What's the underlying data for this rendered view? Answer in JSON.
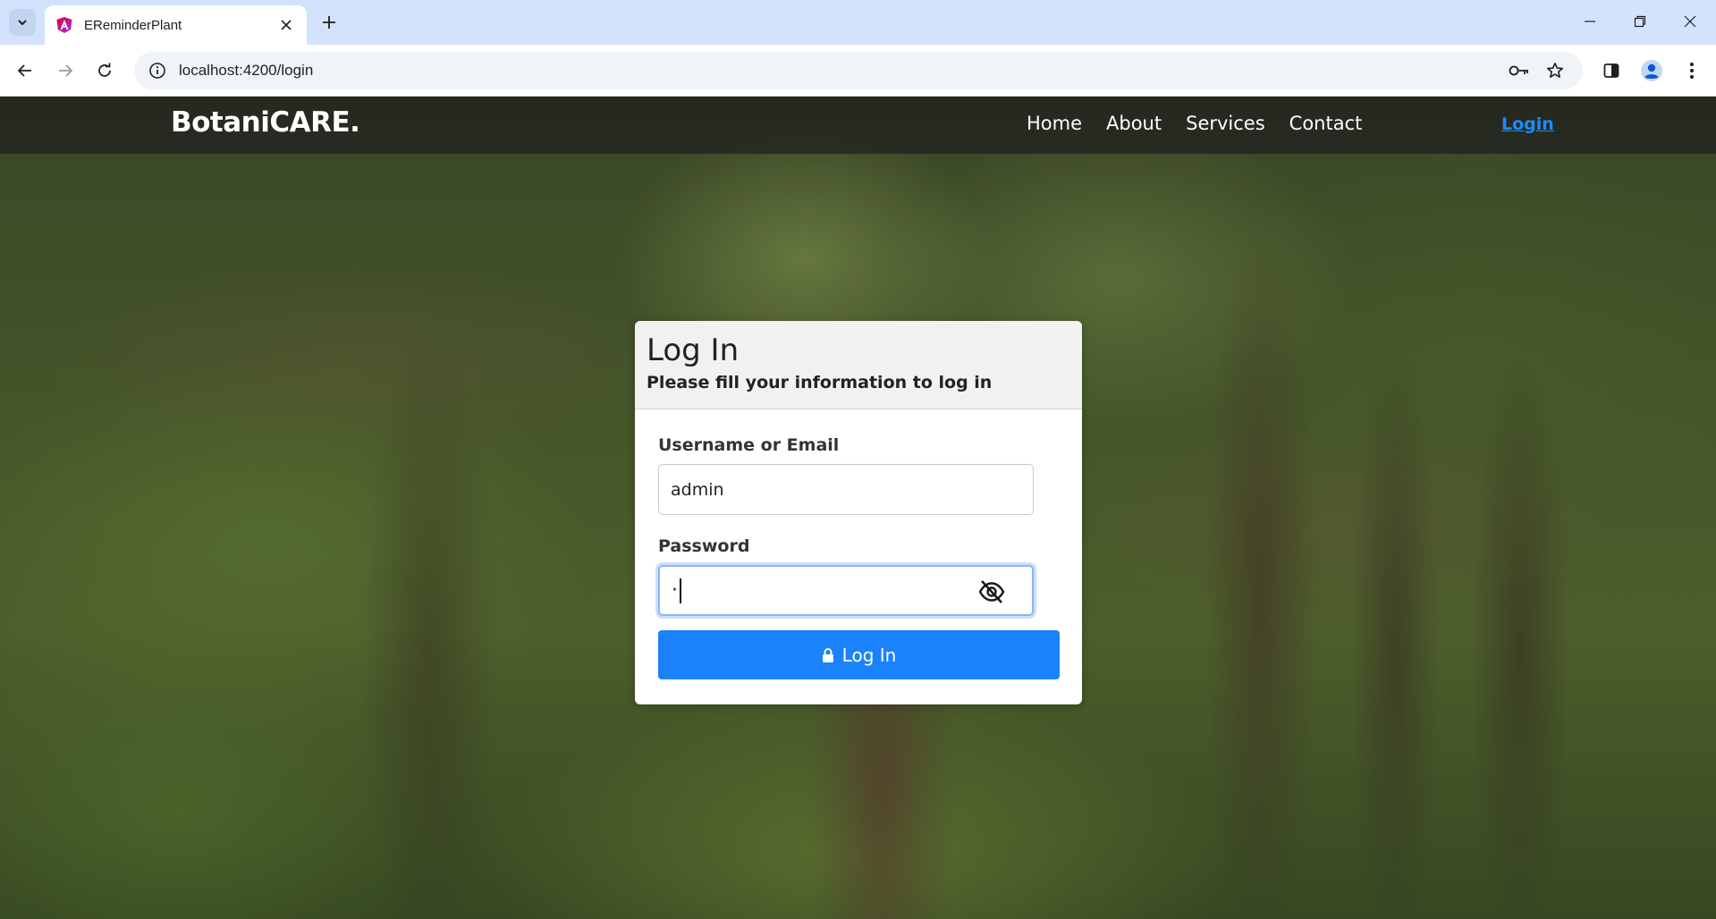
{
  "browser": {
    "tab_title": "EReminderPlant",
    "url": "localhost:4200/login",
    "icons": [
      "tab-list-icon",
      "close-icon",
      "plus-icon",
      "minimize-icon",
      "restore-icon",
      "window-close-icon",
      "back-icon",
      "forward-icon",
      "reload-icon",
      "site-info-icon",
      "key-icon",
      "star-icon",
      "sidebar-icon",
      "profile-icon",
      "more-icon"
    ]
  },
  "navbar": {
    "brand": "BotaniCARE.",
    "links": [
      "Home",
      "About",
      "Services",
      "Contact"
    ],
    "login": "Login"
  },
  "login_card": {
    "title": "Log In",
    "subtitle": "Please fill your information to log in",
    "username_label": "Username or Email",
    "username_value": "admin",
    "password_label": "Password",
    "password_value": "·",
    "button_label": "Log In",
    "button_color": "#1a82fb"
  },
  "colors": {
    "tabbar": "#d3e3fd",
    "nav_login_link": "#1e8bff"
  }
}
